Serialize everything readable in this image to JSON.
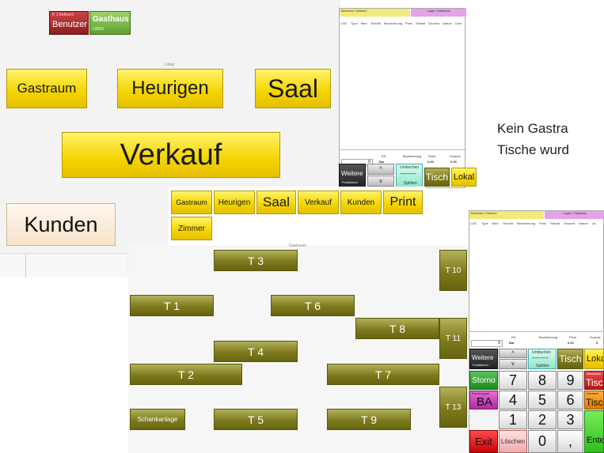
{
  "header": {
    "user_line": "K 1    Kellner1",
    "user_label": "Benutzer",
    "house_label": "Gasthaus",
    "house_code": "L0003"
  },
  "lokal_panel": {
    "title": "Lokal",
    "rooms": [
      "Gastraum",
      "Heurigen",
      "Saal",
      "Verkauf",
      "Kunden"
    ]
  },
  "order_panel": {
    "user_header": "Benutzer: Kellner1",
    "store_header": "Lager: Gasthaus",
    "columns": [
      "C/ID.",
      "Type",
      "Men.",
      "Einheit",
      "Bezeichnung",
      "Preis",
      "Rabatt",
      "Gesamt",
      "Datum",
      "User"
    ],
    "qty_value": "0",
    "eh_label": "EH",
    "eh_value": "Bar",
    "bez_label": "Bezeichnung",
    "price_label": "Preis",
    "price_value": "0,00",
    "sum_label": "Summe",
    "sum_value": "0,00",
    "weitere": "Weitere",
    "funktionen": "Funktionen",
    "up": "^",
    "down": "v",
    "umbuchen": "Umbuchen",
    "dashes": "---------",
    "splitten": "Splitten",
    "tisch": "Tisch",
    "lokal": "Lokal"
  },
  "note": {
    "line1": "Kein Gastra",
    "line2": "Tische wurd"
  },
  "room_bar": {
    "buttons": [
      "Gastraum",
      "Heurigen",
      "Saal",
      "Verkauf",
      "Kunden",
      "Print",
      "Zimmer"
    ]
  },
  "floor": {
    "title": "Gastraum",
    "tables": [
      "T 3",
      "T 10",
      "T 1",
      "T 6",
      "T 8",
      "T 11",
      "T 4",
      "T 2",
      "T 7",
      "T 13",
      "Schankanlage",
      "T 5",
      "T 9"
    ]
  },
  "keypad_panel": {
    "user_header": "Benutzer: Kellner1",
    "store_header": "Lager: Gasthaus",
    "columns": [
      "C/ID.",
      "Type",
      "Men.",
      "Einheit",
      "Bezeichnung",
      "Preis",
      "Rabatt",
      "Gesamt",
      "Datum",
      "Us"
    ],
    "qty_value": "0",
    "eh_label": "EH",
    "eh_value": "Bar",
    "bez_label": "Bezeichnung",
    "price_label": "Preis",
    "price_value": "0,00",
    "sum_label": "Summe",
    "sum_value": "0,",
    "weitere": "Weitere",
    "funktionen": "Funktionen",
    "up": "^",
    "down": "v",
    "umbuchen": "Umbuchen",
    "dashes": "---------",
    "splitten": "Splitten",
    "tisch": "Tisch",
    "lokal": "Loka",
    "storno": "Storno",
    "buchungsart": "Buchungsart",
    "ba": "BA",
    "exit": "Exit",
    "loeschen": "Löschen",
    "keys": [
      "7",
      "8",
      "9",
      "4",
      "5",
      "6",
      "1",
      "2",
      "3",
      "0",
      ","
    ],
    "tisch_red": "Tisc",
    "abschluss": "Abschluss",
    "tisch_orange": "Tisc",
    "drucken": "Drucken",
    "enter": "Ente"
  },
  "colors": {
    "yellow": "#f4d400",
    "olive": "#7d7a1e",
    "red": "#c42b2b",
    "green": "#5f9f2e",
    "violet": "#e3a3e9"
  }
}
